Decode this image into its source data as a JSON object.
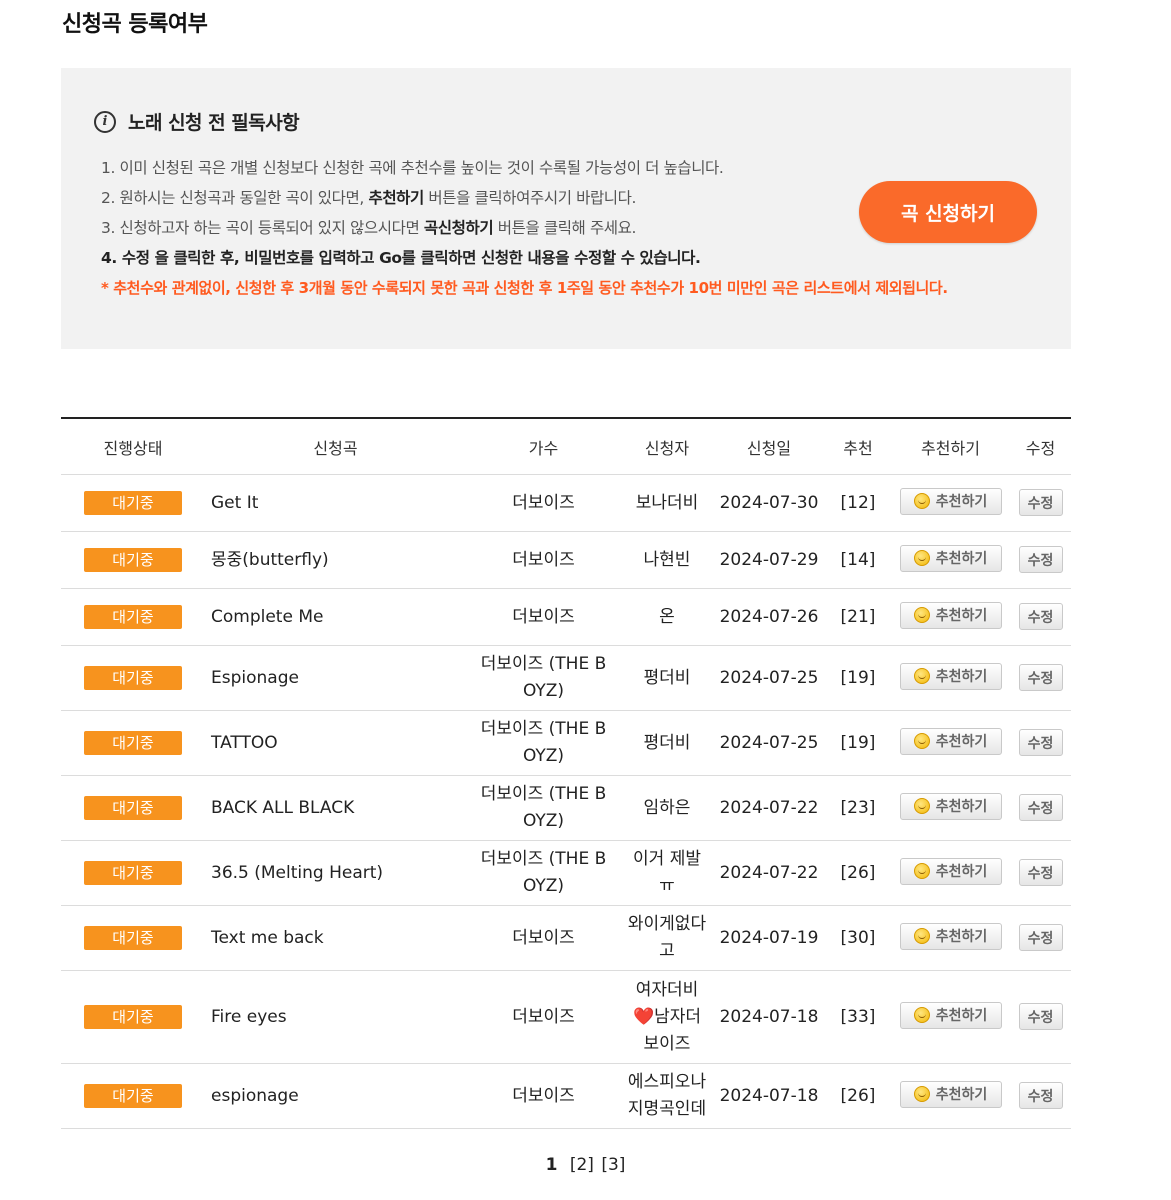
{
  "page": {
    "title": "신청곡 등록여부"
  },
  "notice": {
    "title": "노래 신청 전 필독사항",
    "line1": "1. 이미 신청된 곡은 개별 신청보다 신청한 곡에 추천수를 높이는 것이 수록될 가능성이 더 높습니다.",
    "line2_pre": "2. 원하시는 신청곡과 동일한 곡이 있다면, ",
    "line2_bold": "추천하기",
    "line2_post": " 버튼을 클릭하여주시기 바랍니다.",
    "line3_pre": "3. 신청하고자 하는 곡이 등록되어 있지 않으시다면 ",
    "line3_bold": "곡신청하기",
    "line3_post": " 버튼을 클릭해 주세요.",
    "line4": "4. 수정 을 클릭한 후, 비밀번호를 입력하고 Go를 클릭하면 신청한 내용을 수정할 수 있습니다.",
    "warning": "* 추천수와 관계없이, 신청한 후 3개월 동안 수록되지 못한 곡과 신청한 후 1주일 동안 추천수가 10번 미만인 곡은 리스트에서 제외됩니다.",
    "apply_button": "곡 신청하기"
  },
  "table": {
    "headers": {
      "status": "진행상태",
      "song": "신청곡",
      "artist": "가수",
      "requester": "신청자",
      "date": "신청일",
      "votes": "추천",
      "recommend": "추천하기",
      "edit": "수정"
    },
    "recommend_label": "추천하기",
    "edit_label": "수정",
    "rows": [
      {
        "status": "대기중",
        "song": "Get It",
        "artist": "더보이즈",
        "requester": "보나더비",
        "requester_heart": "",
        "requester_after": "",
        "date": "2024-07-30",
        "votes": "[12]"
      },
      {
        "status": "대기중",
        "song": "몽중(butterfly)",
        "artist": "더보이즈",
        "requester": "나현빈",
        "requester_heart": "",
        "requester_after": "",
        "date": "2024-07-29",
        "votes": "[14]"
      },
      {
        "status": "대기중",
        "song": "Complete Me",
        "artist": "더보이즈",
        "requester": "온",
        "requester_heart": "",
        "requester_after": "",
        "date": "2024-07-26",
        "votes": "[21]"
      },
      {
        "status": "대기중",
        "song": "Espionage",
        "artist": "더보이즈 (THE B OYZ)",
        "requester": "평더비",
        "requester_heart": "",
        "requester_after": "",
        "date": "2024-07-25",
        "votes": "[19]"
      },
      {
        "status": "대기중",
        "song": "TATTOO",
        "artist": "더보이즈 (THE B OYZ)",
        "requester": "평더비",
        "requester_heart": "",
        "requester_after": "",
        "date": "2024-07-25",
        "votes": "[19]"
      },
      {
        "status": "대기중",
        "song": "BACK ALL BLACK",
        "artist": "더보이즈 (THE B OYZ)",
        "requester": "임하은",
        "requester_heart": "",
        "requester_after": "",
        "date": "2024-07-22",
        "votes": "[23]"
      },
      {
        "status": "대기중",
        "song": "36.5 (Melting Heart)",
        "artist": "더보이즈 (THE B OYZ)",
        "requester": "이거 제발 ㅠ",
        "requester_heart": "",
        "requester_after": "",
        "date": "2024-07-22",
        "votes": "[26]"
      },
      {
        "status": "대기중",
        "song": "Text me back",
        "artist": "더보이즈",
        "requester": "와이게없다 고",
        "requester_heart": "",
        "requester_after": "",
        "date": "2024-07-19",
        "votes": "[30]"
      },
      {
        "status": "대기중",
        "song": "Fire eyes",
        "artist": "더보이즈",
        "requester": "여자더비",
        "requester_heart": "❤️",
        "requester_after": "남자더 보이즈",
        "date": "2024-07-18",
        "votes": "[33]"
      },
      {
        "status": "대기중",
        "song": "espionage",
        "artist": "더보이즈",
        "requester": "에스피오나 지명곡인데",
        "requester_heart": "",
        "requester_after": "",
        "date": "2024-07-18",
        "votes": "[26]"
      }
    ]
  },
  "pagination": {
    "current": "1",
    "pages": [
      "[2]",
      "[3]"
    ]
  },
  "colors": {
    "accent": "#fa6a2a",
    "status_badge": "#f7931e",
    "warning": "#ff5a1f",
    "notice_bg": "#f2f2f2"
  }
}
